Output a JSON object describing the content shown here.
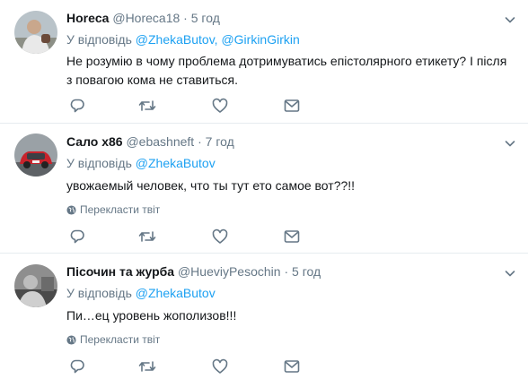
{
  "tweets": [
    {
      "name": "Horeca",
      "handle": "@Horeca18",
      "dot": "·",
      "time": "5 год",
      "replying_prefix": "У відповідь ",
      "mentions": "@ZhekaButov, @GirkinGirkin",
      "text": "Не розумію в чому проблема дотримуватись епістолярного етикету? І після з повагою кома не ставиться.",
      "avatar_icon": "person-photo"
    },
    {
      "name": "Сало х86",
      "handle": "@ebashneft",
      "dot": "·",
      "time": "7 год",
      "replying_prefix": "У відповідь ",
      "mentions": "@ZhekaButov",
      "text": "увожаемый человек, что ты тут ето самое вот??!!",
      "translate_label": "Перекласти твіт",
      "avatar_icon": "red-car-photo"
    },
    {
      "name": "Пісочин та журба",
      "handle": "@HueviyPesochin",
      "dot": "·",
      "time": "5 год",
      "replying_prefix": "У відповідь ",
      "mentions": "@ZhekaButov",
      "text": "Пи…ец уровень жополизов!!!",
      "translate_label": "Перекласти твіт",
      "avatar_icon": "grayscale-photo"
    }
  ],
  "colors": {
    "text": "#14171a",
    "secondary": "#657786",
    "link": "#1da1f2",
    "divider": "#e6ecf0"
  },
  "icons": [
    "reply-icon",
    "retweet-icon",
    "like-icon",
    "direct-message-icon",
    "chevron-down-icon",
    "globe-icon"
  ]
}
